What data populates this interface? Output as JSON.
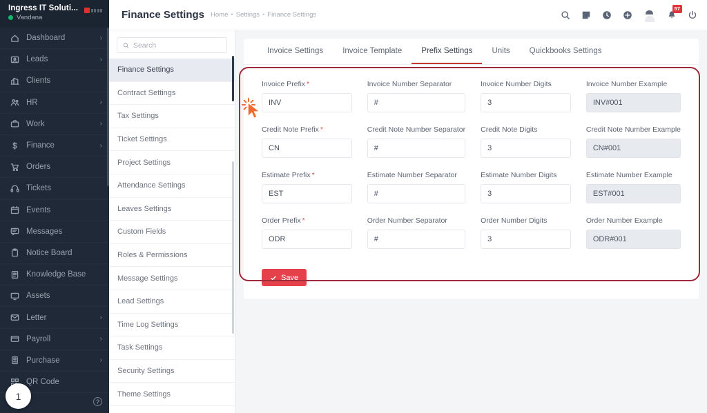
{
  "sidebar": {
    "brand_name": "Ingress IT Soluti...",
    "user_name": "Vandana",
    "items": [
      {
        "label": "Dashboard",
        "icon": "home-icon",
        "chevron": "›"
      },
      {
        "label": "Leads",
        "icon": "leads-icon",
        "chevron": "›"
      },
      {
        "label": "Clients",
        "icon": "clients-icon",
        "chevron": ""
      },
      {
        "label": "HR",
        "icon": "hr-icon",
        "chevron": "›"
      },
      {
        "label": "Work",
        "icon": "briefcase-icon",
        "chevron": "›"
      },
      {
        "label": "Finance",
        "icon": "dollar-icon",
        "chevron": "›"
      },
      {
        "label": "Orders",
        "icon": "cart-icon",
        "chevron": ""
      },
      {
        "label": "Tickets",
        "icon": "headset-icon",
        "chevron": ""
      },
      {
        "label": "Events",
        "icon": "calendar-icon",
        "chevron": ""
      },
      {
        "label": "Messages",
        "icon": "message-icon",
        "chevron": ""
      },
      {
        "label": "Notice Board",
        "icon": "clipboard-icon",
        "chevron": ""
      },
      {
        "label": "Knowledge Base",
        "icon": "book-icon",
        "chevron": ""
      },
      {
        "label": "Assets",
        "icon": "monitor-icon",
        "chevron": ""
      },
      {
        "label": "Letter",
        "icon": "envelope-icon",
        "chevron": "›"
      },
      {
        "label": "Payroll",
        "icon": "wallet-icon",
        "chevron": "›"
      },
      {
        "label": "Purchase",
        "icon": "purchase-icon",
        "chevron": "›"
      },
      {
        "label": "QR Code",
        "icon": "qr-icon",
        "chevron": ""
      }
    ],
    "step_badge": "1",
    "help_label": "?"
  },
  "header": {
    "title": "Finance Settings",
    "breadcrumb": [
      "Home",
      "Settings",
      "Finance Settings"
    ],
    "separator": "•",
    "icons": [
      "search-icon",
      "note-icon",
      "clock-icon",
      "plus-circle-icon",
      "avatar",
      "bell-icon",
      "power-icon"
    ],
    "notification_count": "57"
  },
  "settings_nav": {
    "search_placeholder": "Search",
    "search_value": "",
    "items": [
      "Finance Settings",
      "Contract Settings",
      "Tax Settings",
      "Ticket Settings",
      "Project Settings",
      "Attendance Settings",
      "Leaves Settings",
      "Custom Fields",
      "Roles & Permissions",
      "Message Settings",
      "Lead Settings",
      "Time Log Settings",
      "Task Settings",
      "Security Settings",
      "Theme Settings"
    ],
    "active_index": 0
  },
  "tabs": {
    "items": [
      "Invoice Settings",
      "Invoice Template",
      "Prefix Settings",
      "Units",
      "Quickbooks Settings"
    ],
    "active_index": 2
  },
  "form": {
    "fields": [
      {
        "label": "Invoice Prefix",
        "required": true,
        "value": "INV",
        "readonly": false
      },
      {
        "label": "Invoice Number Separator",
        "required": false,
        "value": "#",
        "readonly": false
      },
      {
        "label": "Invoice Number Digits",
        "required": false,
        "value": "3",
        "readonly": false
      },
      {
        "label": "Invoice Number Example",
        "required": false,
        "value": "INV#001",
        "readonly": true
      },
      {
        "label": "Credit Note Prefix",
        "required": true,
        "value": "CN",
        "readonly": false
      },
      {
        "label": "Credit Note Number Separator",
        "required": false,
        "value": "#",
        "readonly": false
      },
      {
        "label": "Credit Note Digits",
        "required": false,
        "value": "3",
        "readonly": false
      },
      {
        "label": "Credit Note Number Example",
        "required": false,
        "value": "CN#001",
        "readonly": true
      },
      {
        "label": "Estimate Prefix",
        "required": true,
        "value": "EST",
        "readonly": false
      },
      {
        "label": "Estimate Number Separator",
        "required": false,
        "value": "#",
        "readonly": false
      },
      {
        "label": "Estimate Number Digits",
        "required": false,
        "value": "3",
        "readonly": false
      },
      {
        "label": "Estimate Number Example",
        "required": false,
        "value": "EST#001",
        "readonly": true
      },
      {
        "label": "Order Prefix",
        "required": true,
        "value": "ODR",
        "readonly": false
      },
      {
        "label": "Order Number Separator",
        "required": false,
        "value": "#",
        "readonly": false
      },
      {
        "label": "Order Number Digits",
        "required": false,
        "value": "3",
        "readonly": false
      },
      {
        "label": "Order Number Example",
        "required": false,
        "value": "ODR#001",
        "readonly": true
      }
    ],
    "save_label": "Save"
  },
  "colors": {
    "sidebar_bg": "#1f2937",
    "accent_red": "#e4414a",
    "tab_active": "#c0392f",
    "annotation": "#9e2b3a",
    "cursor": "#f26a2e",
    "online": "#12b76a"
  }
}
